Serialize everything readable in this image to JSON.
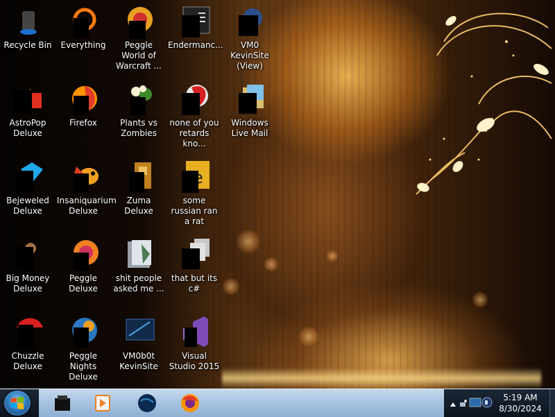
{
  "desktop": {
    "icons": [
      {
        "label": "Recycle Bin",
        "icon": "recycle-bin-icon"
      },
      {
        "label": "Everything",
        "icon": "everything-search-icon"
      },
      {
        "label": "Peggle World of Warcraft ...",
        "icon": "peggle-icon"
      },
      {
        "label": "Endermanc...",
        "icon": "terminal-icon"
      },
      {
        "label": "VM0 KevinSite (View)",
        "icon": "globe-icon"
      },
      {
        "label": "AstroPop Deluxe",
        "icon": "astropop-icon"
      },
      {
        "label": "Firefox",
        "icon": "firefox-icon"
      },
      {
        "label": "Plants vs Zombies",
        "icon": "plants-vs-zombies-icon"
      },
      {
        "label": "none of you retards kno...",
        "icon": "red-app-icon"
      },
      {
        "label": "Windows Live Mail",
        "icon": "mail-icon"
      },
      {
        "label": "Bejeweled Deluxe",
        "icon": "bejeweled-icon"
      },
      {
        "label": "Insaniquarium Deluxe",
        "icon": "fish-icon"
      },
      {
        "label": "Zuma Deluxe",
        "icon": "zuma-icon"
      },
      {
        "label": "some russian ran a rat",
        "icon": "document-icon"
      },
      {
        "label": "Big Money Deluxe",
        "icon": "big-money-icon"
      },
      {
        "label": "Peggle Deluxe",
        "icon": "peggle-icon"
      },
      {
        "label": "shit people asked me ...",
        "icon": "folder-icon"
      },
      {
        "label": "that but its c#",
        "icon": "folder-stack-icon"
      },
      {
        "label": "Chuzzle Deluxe",
        "icon": "chuzzle-icon"
      },
      {
        "label": "Peggle Nights Deluxe",
        "icon": "peggle-nights-icon"
      },
      {
        "label": "VM0b0t KevinSite",
        "icon": "vm-icon"
      },
      {
        "label": "Visual Studio 2015",
        "icon": "visual-studio-icon"
      }
    ]
  },
  "taskbar": {
    "pinned": [
      {
        "name": "recycle-bin-icon"
      },
      {
        "name": "media-player-icon"
      },
      {
        "name": "globe-icon"
      },
      {
        "name": "firefox-icon"
      }
    ],
    "clock": {
      "time": "5:19 AM",
      "date": "8/30/2024"
    }
  },
  "colors": {
    "taskbar": "#a6c2e0",
    "tray": "#0c141e",
    "label_text": "#ffffff"
  }
}
